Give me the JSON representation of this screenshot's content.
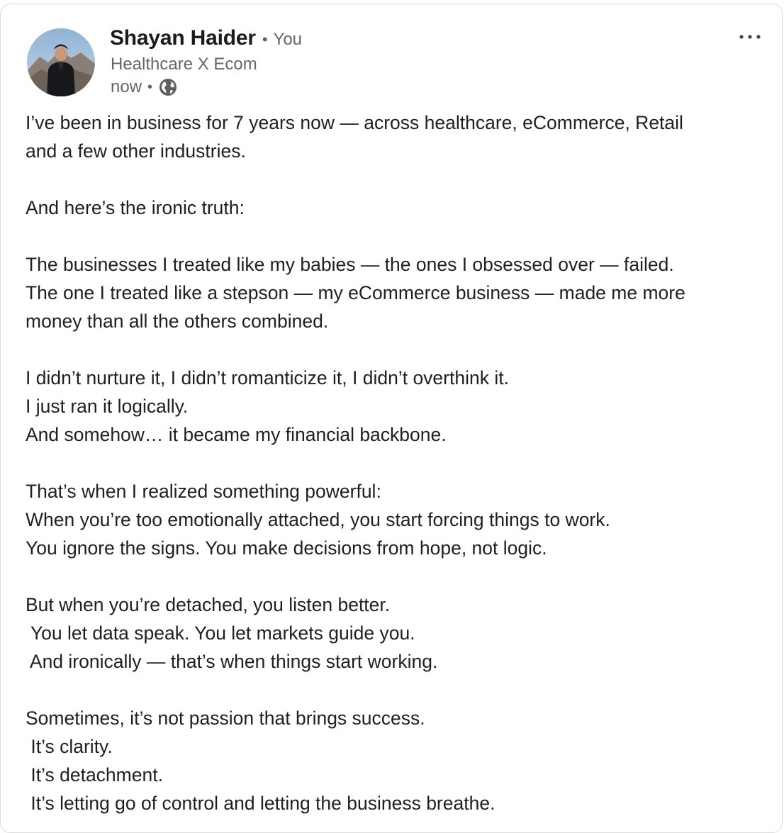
{
  "post": {
    "author_name": "Shayan Haider",
    "separator": "•",
    "connection": "You",
    "headline": "Healthcare X Ecom",
    "timestamp": "now",
    "meta_separator": "•",
    "visibility_icon": "globe-icon",
    "menu_icon": "more-horizontal-icon",
    "lines": [
      "I’ve been in business for 7 years now — across healthcare, eCommerce, Retail",
      "and a few other industries.",
      "",
      "And here’s the ironic truth:",
      "",
      "The businesses I treated like my babies — the ones I obsessed over — failed.",
      "The one I treated like a stepson — my eCommerce business — made me more",
      "money than all the others combined.",
      "",
      "I didn’t nurture it, I didn’t romanticize it, I didn’t overthink it.",
      "I just ran it logically.",
      "And somehow… it became my financial backbone.",
      "",
      "That’s when I realized something powerful:",
      "When you’re too emotionally attached, you start forcing things to work.",
      "You ignore the signs. You make decisions from hope, not logic.",
      "",
      "But when you’re detached, you listen better.",
      " You let data speak. You let markets guide you.",
      " And ironically — that’s when things start working.",
      "",
      "Sometimes, it’s not passion that brings success.",
      " It’s clarity.",
      " It’s detachment.",
      " It’s letting go of control and letting the business breathe."
    ]
  },
  "colors": {
    "text_primary": "#1f1f1f",
    "text_secondary": "#666666",
    "card_border": "#dcdcdc",
    "background": "#ffffff"
  }
}
